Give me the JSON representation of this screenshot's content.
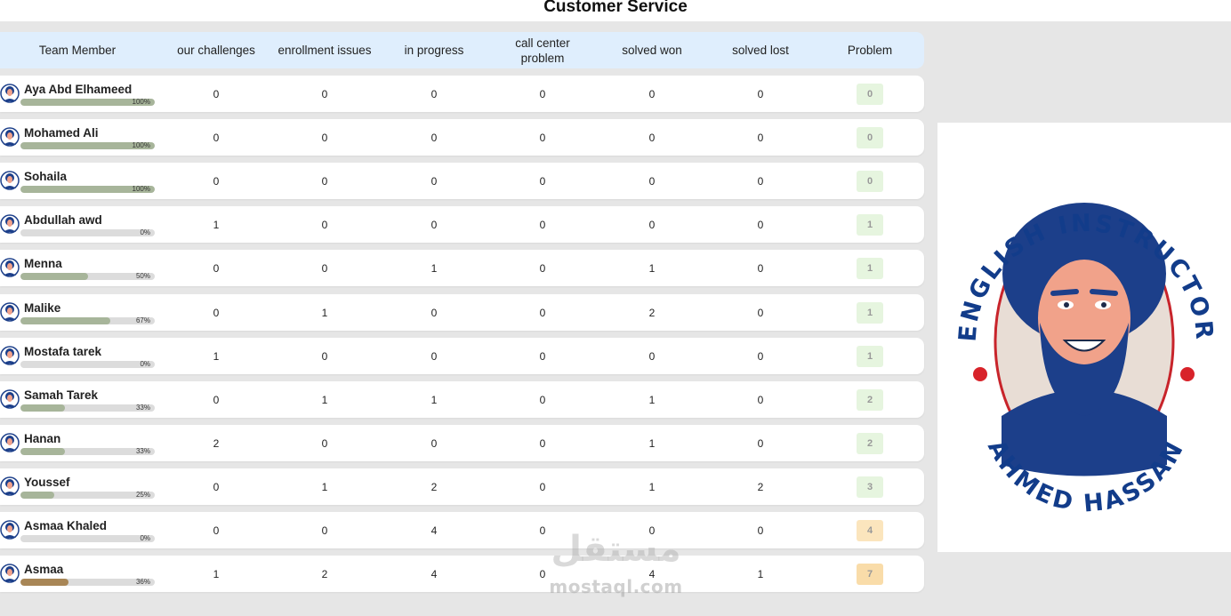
{
  "page": {
    "title": "Customer Service"
  },
  "table": {
    "headers": [
      {
        "label": "Team Member"
      },
      {
        "label": "our challenges"
      },
      {
        "label": "enrollment issues"
      },
      {
        "label": "in progress"
      },
      {
        "label": "call center problem"
      },
      {
        "label": "solved won"
      },
      {
        "label": "solved lost"
      },
      {
        "label": "Problem"
      }
    ],
    "rows": [
      {
        "name": "Aya Abd Elhameed",
        "progress": 100,
        "progress_label": "100%",
        "our_challenges": "0",
        "enrollment_issues": "0",
        "in_progress": "0",
        "call_center_problem": "0",
        "solved_won": "0",
        "solved_lost": "0",
        "problem": "0"
      },
      {
        "name": "Mohamed Ali",
        "progress": 100,
        "progress_label": "100%",
        "our_challenges": "0",
        "enrollment_issues": "0",
        "in_progress": "0",
        "call_center_problem": "0",
        "solved_won": "0",
        "solved_lost": "0",
        "problem": "0"
      },
      {
        "name": "Sohaila",
        "progress": 100,
        "progress_label": "100%",
        "our_challenges": "0",
        "enrollment_issues": "0",
        "in_progress": "0",
        "call_center_problem": "0",
        "solved_won": "0",
        "solved_lost": "0",
        "problem": "0"
      },
      {
        "name": "Abdullah awd",
        "progress": 0,
        "progress_label": "0%",
        "our_challenges": "1",
        "enrollment_issues": "0",
        "in_progress": "0",
        "call_center_problem": "0",
        "solved_won": "0",
        "solved_lost": "0",
        "problem": "1"
      },
      {
        "name": "Menna",
        "progress": 50,
        "progress_label": "50%",
        "our_challenges": "0",
        "enrollment_issues": "0",
        "in_progress": "1",
        "call_center_problem": "0",
        "solved_won": "1",
        "solved_lost": "0",
        "problem": "1"
      },
      {
        "name": "Malike",
        "progress": 67,
        "progress_label": "67%",
        "our_challenges": "0",
        "enrollment_issues": "1",
        "in_progress": "0",
        "call_center_problem": "0",
        "solved_won": "2",
        "solved_lost": "0",
        "problem": "1"
      },
      {
        "name": "Mostafa tarek",
        "progress": 0,
        "progress_label": "0%",
        "our_challenges": "1",
        "enrollment_issues": "0",
        "in_progress": "0",
        "call_center_problem": "0",
        "solved_won": "0",
        "solved_lost": "0",
        "problem": "1"
      },
      {
        "name": "Samah Tarek",
        "progress": 33,
        "progress_label": "33%",
        "our_challenges": "0",
        "enrollment_issues": "1",
        "in_progress": "1",
        "call_center_problem": "0",
        "solved_won": "1",
        "solved_lost": "0",
        "problem": "2"
      },
      {
        "name": "Hanan",
        "progress": 33,
        "progress_label": "33%",
        "our_challenges": "2",
        "enrollment_issues": "0",
        "in_progress": "0",
        "call_center_problem": "0",
        "solved_won": "1",
        "solved_lost": "0",
        "problem": "2"
      },
      {
        "name": "Youssef",
        "progress": 25,
        "progress_label": "25%",
        "our_challenges": "0",
        "enrollment_issues": "1",
        "in_progress": "2",
        "call_center_problem": "0",
        "solved_won": "1",
        "solved_lost": "2",
        "problem": "3"
      },
      {
        "name": "Asmaa Khaled",
        "progress": 0,
        "progress_label": "0%",
        "our_challenges": "0",
        "enrollment_issues": "0",
        "in_progress": "4",
        "call_center_problem": "0",
        "solved_won": "0",
        "solved_lost": "0",
        "problem": "4"
      },
      {
        "name": "Asmaa",
        "progress": 36,
        "progress_label": "36%",
        "our_challenges": "1",
        "enrollment_issues": "2",
        "in_progress": "4",
        "call_center_problem": "0",
        "solved_won": "4",
        "solved_lost": "1",
        "problem": "7"
      }
    ]
  },
  "colors": {
    "header_bg": "#dfeefd",
    "progress_fill": "#a7b59a",
    "progress_fill_low": "#a88656",
    "badge_low": "#e6f5df",
    "badge_mid": "#fbe5bd",
    "badge_high": "#f9dca9"
  },
  "logo": {
    "top_text": "ENGLISH INSTRUCTOR",
    "bottom_text": "AHMED HASSAN",
    "icon": "instructor-portrait-logo"
  },
  "watermark": {
    "arabic": "مستقل",
    "latin": "mostaql.com"
  }
}
